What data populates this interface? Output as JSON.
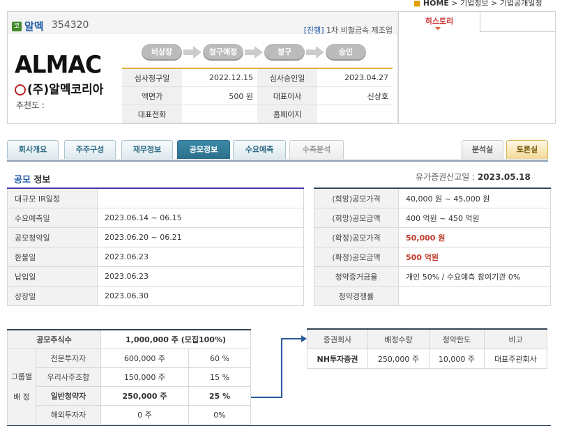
{
  "breadcrumb": {
    "home": "HOME",
    "level1": "기업정보",
    "level2": "기업공개일정"
  },
  "company": {
    "badge": "코",
    "name": "알멕",
    "code": "354320",
    "status_tag": "[진행]",
    "industry": "1차 비철금속 제조업",
    "logo_text": "ALMAC",
    "logo_sub": "(주)알멕코리아",
    "recommend_label": "추천도 :",
    "steps": [
      "비상장",
      "청구예정",
      "청구",
      "승인"
    ],
    "info": {
      "review_request_label": "심사청구일",
      "review_request": "2022.12.15",
      "review_approve_label": "심사승인일",
      "review_approve": "2023.04.27",
      "par_value_label": "액면가",
      "par_value": "500 원",
      "ceo_label": "대표이사",
      "ceo": "신상호",
      "phone_label": "대표전화",
      "phone": "",
      "homepage_label": "홈페이지",
      "homepage": ""
    }
  },
  "history": {
    "tab_label": "히스토리"
  },
  "tabs": [
    "회사개요",
    "주주구성",
    "재무정보",
    "공모정보",
    "수요예측",
    "수측분석"
  ],
  "tabs_right": [
    "분석실",
    "토론실"
  ],
  "active_tab": "공모정보",
  "section": {
    "title_a": "공모",
    "title_b": " 정보",
    "report_label": "유가증권신고일 : ",
    "report_date": "2023.05.18"
  },
  "schedule": [
    {
      "label": "대규모 IR일정",
      "value": ""
    },
    {
      "label": "수요예측일",
      "value": "2023.06.14 ~ 06.15"
    },
    {
      "label": "공모청약일",
      "value": "2023.06.20 ~ 06.21"
    },
    {
      "label": "환불일",
      "value": "2023.06.23"
    },
    {
      "label": "납입일",
      "value": "2023.06.23"
    },
    {
      "label": "상장일",
      "value": "2023.06.30"
    }
  ],
  "pricing": [
    {
      "label": "(희망)공모가격",
      "value": "40,000 원 ~ 45,000 원"
    },
    {
      "label": "(희망)공모금액",
      "value": "400 억원  ~ 450 억원"
    },
    {
      "label": "(확정)공모가격",
      "value": "50,000 원"
    },
    {
      "label": "(확정)공모금액",
      "value": "500 억원"
    },
    {
      "label": "청약증거금율",
      "value": "개인 50% / 수요예측 참여기관 0%"
    },
    {
      "label": "청약경쟁률",
      "value": ""
    }
  ],
  "allocation": {
    "total_label": "공모주식수",
    "total_value": "1,000,000 주 (모집100%)",
    "group_label_1": "그룹별",
    "group_label_2": "배 정",
    "rows": [
      {
        "label": "전문투자자",
        "shares": "600,000 주",
        "pct": "60 %"
      },
      {
        "label": "우리사주조합",
        "shares": "150,000 주",
        "pct": "15 %"
      },
      {
        "label": "일반청약자",
        "shares": "250,000 주",
        "pct": "25 %"
      },
      {
        "label": "해외투자자",
        "shares": "0 주",
        "pct": "0%"
      }
    ]
  },
  "broker": {
    "headers": [
      "증권회사",
      "배정수량",
      "청약한도",
      "비고"
    ],
    "rows": [
      {
        "name": "NH투자증권",
        "shares": "250,000 주",
        "limit": "10,000 주",
        "note": "대표주관회사"
      }
    ]
  }
}
